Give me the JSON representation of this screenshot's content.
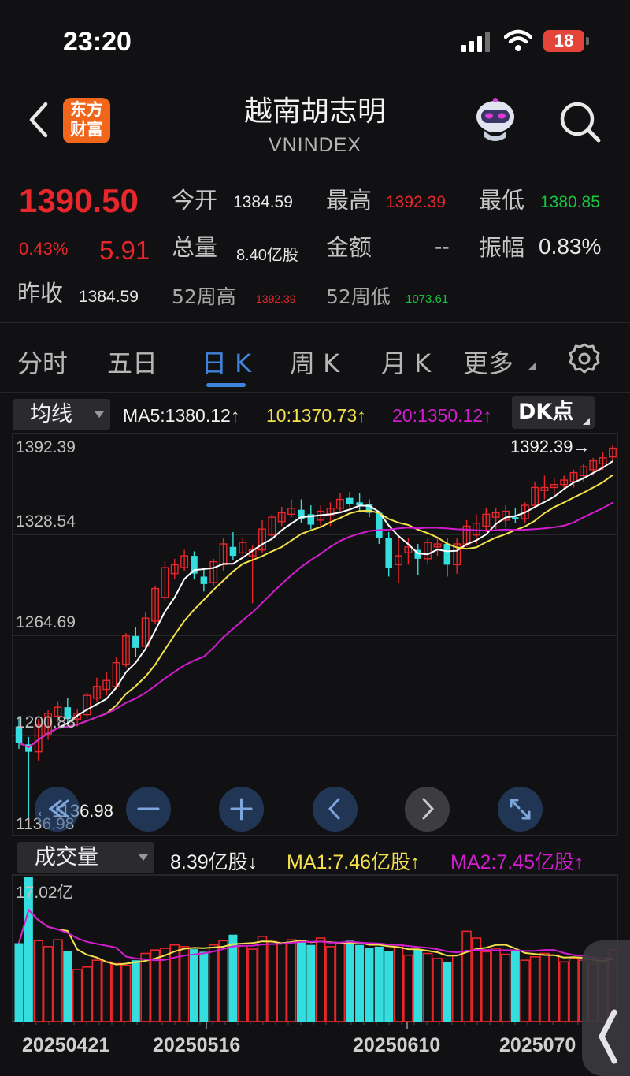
{
  "status_bar": {
    "time": "23:20",
    "battery": "18"
  },
  "header": {
    "logo_text": "东方\n财富",
    "title": "越南胡志明",
    "subtitle": "VNINDEX"
  },
  "quote": {
    "price": "1390.50",
    "change_pct": "0.43%",
    "change": "5.91",
    "open_label": "今开",
    "open": "1384.59",
    "high_label": "最高",
    "high": "1392.39",
    "low_label": "最低",
    "low": "1380.85",
    "volume_label": "总量",
    "volume": "8.40亿股",
    "amount_label": "金额",
    "amount": "--",
    "amplitude_label": "振幅",
    "amplitude": "0.83%",
    "prev_close_label": "昨收",
    "prev_close": "1384.59",
    "week52_high_label": "52周高",
    "week52_high": "1392.39",
    "week52_low_label": "52周低",
    "week52_low": "1073.61"
  },
  "tabs": [
    {
      "label": "分时"
    },
    {
      "label": "五日"
    },
    {
      "label": "日 K"
    },
    {
      "label": "周 K"
    },
    {
      "label": "月 K"
    },
    {
      "label": "更多"
    }
  ],
  "active_tab": "日 K",
  "indicator": {
    "dropdown": "均线",
    "ma5": "MA5:1380.12↑",
    "ma10": "10:1370.73↑",
    "ma20": "20:1350.12↑",
    "dk_button": "DK点"
  },
  "price_axis": [
    "1392.39",
    "1328.54",
    "1264.69",
    "1200.83",
    "1136.98"
  ],
  "marker_high": "1392.39→",
  "marker_low": "←1136.98",
  "volume_panel": {
    "dropdown": "成交量",
    "current": "8.39亿股↓",
    "ma1": "MA1:7.46亿股↑",
    "ma2": "MA2:7.45亿股↑",
    "max_label": "17.02亿"
  },
  "dates": [
    "20250421",
    "20250516",
    "20250610",
    "2025070"
  ],
  "colors": {
    "up": "#e8262b",
    "down": "#35dede",
    "ma5": "#ffffff",
    "ma10": "#f3e14b",
    "ma20": "#d21cd0",
    "accent": "#3f84dc",
    "green": "#17c53f"
  },
  "icons": [
    "back-icon",
    "robot-assistant-icon",
    "search-icon",
    "settings-icon",
    "rewind-icon",
    "zoom-out-icon",
    "zoom-in-icon",
    "scroll-left-icon",
    "scroll-right-icon",
    "fullscreen-icon",
    "side-handle-icon"
  ],
  "chart_data": {
    "type": "candlestick",
    "y_range": [
      1136.98,
      1392.39
    ],
    "candles": [
      {
        "o": 1203,
        "h": 1210,
        "l": 1188,
        "c": 1192
      },
      {
        "o": 1191,
        "h": 1196,
        "l": 1136.98,
        "c": 1186
      },
      {
        "o": 1186,
        "h": 1208,
        "l": 1180,
        "c": 1204
      },
      {
        "o": 1198,
        "h": 1214,
        "l": 1194,
        "c": 1212
      },
      {
        "o": 1210,
        "h": 1220,
        "l": 1206,
        "c": 1216
      },
      {
        "o": 1216,
        "h": 1222,
        "l": 1204,
        "c": 1208
      },
      {
        "o": 1208,
        "h": 1215,
        "l": 1203,
        "c": 1212
      },
      {
        "o": 1211,
        "h": 1226,
        "l": 1208,
        "c": 1224
      },
      {
        "o": 1222,
        "h": 1236,
        "l": 1220,
        "c": 1230
      },
      {
        "o": 1228,
        "h": 1240,
        "l": 1224,
        "c": 1234
      },
      {
        "o": 1230,
        "h": 1250,
        "l": 1228,
        "c": 1246
      },
      {
        "o": 1245,
        "h": 1266,
        "l": 1243,
        "c": 1264
      },
      {
        "o": 1264,
        "h": 1270,
        "l": 1250,
        "c": 1256
      },
      {
        "o": 1257,
        "h": 1280,
        "l": 1254,
        "c": 1276
      },
      {
        "o": 1274,
        "h": 1298,
        "l": 1272,
        "c": 1296
      },
      {
        "o": 1290,
        "h": 1314,
        "l": 1288,
        "c": 1310
      },
      {
        "o": 1306,
        "h": 1316,
        "l": 1302,
        "c": 1312
      },
      {
        "o": 1310,
        "h": 1322,
        "l": 1308,
        "c": 1318
      },
      {
        "o": 1318,
        "h": 1321,
        "l": 1302,
        "c": 1306
      },
      {
        "o": 1304,
        "h": 1310,
        "l": 1294,
        "c": 1299
      },
      {
        "o": 1300,
        "h": 1316,
        "l": 1298,
        "c": 1314
      },
      {
        "o": 1312,
        "h": 1330,
        "l": 1308,
        "c": 1326
      },
      {
        "o": 1324,
        "h": 1334,
        "l": 1315,
        "c": 1318
      },
      {
        "o": 1320,
        "h": 1330,
        "l": 1316,
        "c": 1327
      },
      {
        "o": 1318,
        "h": 1325,
        "l": 1286,
        "c": 1322
      },
      {
        "o": 1322,
        "h": 1342,
        "l": 1320,
        "c": 1336
      },
      {
        "o": 1332,
        "h": 1346,
        "l": 1328,
        "c": 1344
      },
      {
        "o": 1341,
        "h": 1351,
        "l": 1338,
        "c": 1347
      },
      {
        "o": 1346,
        "h": 1356,
        "l": 1344,
        "c": 1350
      },
      {
        "o": 1349,
        "h": 1356,
        "l": 1340,
        "c": 1343
      },
      {
        "o": 1346,
        "h": 1352,
        "l": 1336,
        "c": 1339
      },
      {
        "o": 1342,
        "h": 1352,
        "l": 1338,
        "c": 1348
      },
      {
        "o": 1345,
        "h": 1354,
        "l": 1338,
        "c": 1350
      },
      {
        "o": 1350,
        "h": 1360,
        "l": 1347,
        "c": 1356
      },
      {
        "o": 1357,
        "h": 1361,
        "l": 1351,
        "c": 1353
      },
      {
        "o": 1354,
        "h": 1360,
        "l": 1348,
        "c": 1352
      },
      {
        "o": 1353,
        "h": 1356,
        "l": 1344,
        "c": 1347
      },
      {
        "o": 1347,
        "h": 1348,
        "l": 1326,
        "c": 1330
      },
      {
        "o": 1330,
        "h": 1334,
        "l": 1304,
        "c": 1310
      },
      {
        "o": 1312,
        "h": 1330,
        "l": 1300,
        "c": 1318
      },
      {
        "o": 1320,
        "h": 1330,
        "l": 1312,
        "c": 1324
      },
      {
        "o": 1322,
        "h": 1326,
        "l": 1305,
        "c": 1316
      },
      {
        "o": 1316,
        "h": 1330,
        "l": 1312,
        "c": 1327
      },
      {
        "o": 1324,
        "h": 1330,
        "l": 1318,
        "c": 1326
      },
      {
        "o": 1326,
        "h": 1330,
        "l": 1304,
        "c": 1312
      },
      {
        "o": 1312,
        "h": 1330,
        "l": 1306,
        "c": 1326
      },
      {
        "o": 1326,
        "h": 1342,
        "l": 1324,
        "c": 1338
      },
      {
        "o": 1332,
        "h": 1346,
        "l": 1326,
        "c": 1340
      },
      {
        "o": 1338,
        "h": 1350,
        "l": 1334,
        "c": 1346
      },
      {
        "o": 1344,
        "h": 1350,
        "l": 1336,
        "c": 1347
      },
      {
        "o": 1342,
        "h": 1352,
        "l": 1337,
        "c": 1348
      },
      {
        "o": 1344,
        "h": 1350,
        "l": 1340,
        "c": 1343
      },
      {
        "o": 1343,
        "h": 1354,
        "l": 1340,
        "c": 1352
      },
      {
        "o": 1352,
        "h": 1368,
        "l": 1350,
        "c": 1364
      },
      {
        "o": 1362,
        "h": 1372,
        "l": 1356,
        "c": 1364
      },
      {
        "o": 1364,
        "h": 1370,
        "l": 1359,
        "c": 1366
      },
      {
        "o": 1366,
        "h": 1372,
        "l": 1362,
        "c": 1369
      },
      {
        "o": 1368,
        "h": 1376,
        "l": 1364,
        "c": 1374
      },
      {
        "o": 1372,
        "h": 1380,
        "l": 1368,
        "c": 1378
      },
      {
        "o": 1376,
        "h": 1384,
        "l": 1372,
        "c": 1382
      },
      {
        "o": 1380,
        "h": 1388,
        "l": 1376,
        "c": 1384
      },
      {
        "o": 1384.59,
        "h": 1392.39,
        "l": 1380.85,
        "c": 1390.5
      }
    ],
    "volume_ylim": [
      0,
      17.02
    ],
    "volumes": [
      9.2,
      17.02,
      9.5,
      8.8,
      9.6,
      8.3,
      6.1,
      6.4,
      7.2,
      7.0,
      6.8,
      6.6,
      7.2,
      8.0,
      8.4,
      8.6,
      9.0,
      8.8,
      8.5,
      8.2,
      9.0,
      9.5,
      10.2,
      8.9,
      8.5,
      10.0,
      9.4,
      9.2,
      9.6,
      9.4,
      9.0,
      9.8,
      8.8,
      9.2,
      9.5,
      9.0,
      8.6,
      8.8,
      8.3,
      9.0,
      7.8,
      8.5,
      8.0,
      7.4,
      7.0,
      7.8,
      10.6,
      9.8,
      8.2,
      8.6,
      7.9,
      8.4,
      7.2,
      7.6,
      8.0,
      7.8,
      7.0,
      7.4,
      7.2,
      6.8,
      7.0,
      8.39
    ]
  }
}
